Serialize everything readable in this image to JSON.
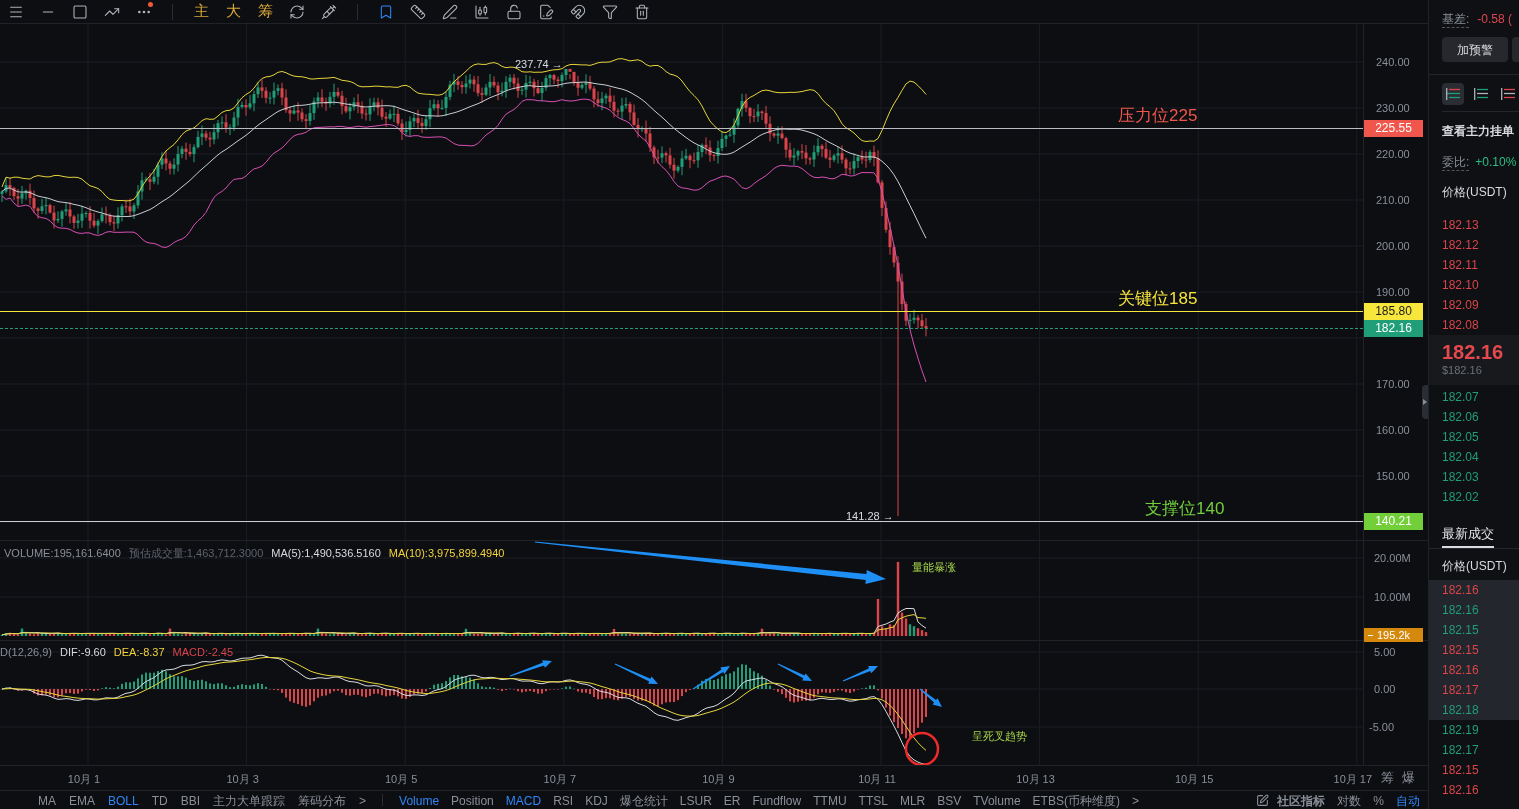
{
  "toolbar": {
    "indicator_buttons": [
      "主",
      "大",
      "筹"
    ]
  },
  "chart": {
    "high_label": "237.74 →",
    "low_label": "141.28 →",
    "levels": [
      {
        "kind": "resistance",
        "label": "压力位225",
        "badge": "225.55",
        "color": "#f0564c"
      },
      {
        "kind": "key",
        "label": "关键位185",
        "badge": "185.80",
        "color": "#f7e63c"
      },
      {
        "kind": "support",
        "label": "支撑位140",
        "badge": "140.21",
        "color": "#72cf3a"
      }
    ],
    "last_price": {
      "badge": "182.16",
      "color": "#1f9e78"
    },
    "price_ticks": [
      "240.00",
      "230.00",
      "220.00",
      "210.00",
      "200.00",
      "190.00"
    ],
    "lower_price_ticks": [
      "170.00",
      "160.00",
      "150.00"
    ]
  },
  "volume": {
    "legend": [
      {
        "text": "VOLUME:195,161.6400",
        "color": "#8a8f98"
      },
      {
        "text": "预估成交量:1,463,712.3000",
        "color": "#5d626b"
      },
      {
        "text": "MA(5):1,490,536.5160",
        "color": "#d9dbe0"
      },
      {
        "text": "MA(10):3,975,899.4940",
        "color": "#f2d43c"
      }
    ],
    "ticks": [
      "20.00M",
      "10.00M"
    ],
    "badge": "195.2k",
    "annotation": "量能暴涨"
  },
  "macd": {
    "legend": [
      {
        "text": "D(12,26,9)",
        "color": "#8a8f98"
      },
      {
        "text": "DIF:-9.60",
        "color": "#d9dbe0"
      },
      {
        "text": "DEA:-8.37",
        "color": "#f2d43c"
      },
      {
        "text": "MACD:-2.45",
        "color": "#d9454b"
      }
    ],
    "ticks": [
      "5.00",
      "0.00",
      "-5.00"
    ],
    "annotation": "呈死叉趋势"
  },
  "date_axis": [
    "10月 1",
    "10月 3",
    "10月 5",
    "10月 7",
    "10月 9",
    "10月 11",
    "10月 13",
    "10月 15",
    "10月 17"
  ],
  "axis_buttons": [
    "筹",
    "爆"
  ],
  "main_indicators": [
    {
      "label": "MA",
      "selected": false
    },
    {
      "label": "EMA",
      "selected": false
    },
    {
      "label": "BOLL",
      "selected": true
    },
    {
      "label": "TD",
      "selected": false
    },
    {
      "label": "BBI",
      "selected": false
    },
    {
      "label": "主力大单跟踪",
      "selected": false
    },
    {
      "label": "筹码分布",
      "selected": false
    },
    {
      "label": ">",
      "selected": false
    }
  ],
  "sub_indicators": [
    {
      "label": "Volume",
      "selected": true
    },
    {
      "label": "Position",
      "selected": false
    },
    {
      "label": "MACD",
      "selected": true
    },
    {
      "label": "RSI",
      "selected": false
    },
    {
      "label": "KDJ",
      "selected": false
    },
    {
      "label": "爆仓统计",
      "selected": false
    },
    {
      "label": "LSUR",
      "selected": false
    },
    {
      "label": "ER",
      "selected": false
    },
    {
      "label": "Fundflow",
      "selected": false
    },
    {
      "label": "TTMU",
      "selected": false
    },
    {
      "label": "TTSL",
      "selected": false
    },
    {
      "label": "MLR",
      "selected": false
    },
    {
      "label": "BSV",
      "selected": false
    },
    {
      "label": "TVolume",
      "selected": false
    },
    {
      "label": "ETBS(币种维度)",
      "selected": false
    },
    {
      "label": ">",
      "selected": false
    }
  ],
  "chart_options": [
    {
      "label": "社区指标",
      "selected": false
    },
    {
      "label": "对数",
      "selected": false
    },
    {
      "label": "%",
      "selected": false
    },
    {
      "label": "自动",
      "selected": true
    }
  ],
  "sidebar": {
    "basis_label": "基差:",
    "basis_value": "-0.58 (",
    "alert_button": "加预警",
    "book_views": [
      {
        "kind": "both",
        "selected": true
      },
      {
        "kind": "bids",
        "selected": false
      },
      {
        "kind": "asks",
        "selected": false
      }
    ],
    "main_orders": "查看主力挂单",
    "ratio_label": "委比:",
    "ratio_value": "+0.10%",
    "book_header": "价格(USDT)",
    "asks": [
      "182.13",
      "182.12",
      "182.11",
      "182.10",
      "182.09",
      "182.08"
    ],
    "mid_price": "182.16",
    "mid_price_usd": "$182.16",
    "bids": [
      "182.07",
      "182.06",
      "182.05",
      "182.04",
      "182.03",
      "182.02"
    ],
    "trades_tab": {
      "label": "最新成交",
      "selected": true
    },
    "trades_header": "价格(USDT)",
    "trades": [
      {
        "price": "182.16",
        "kind": "sell",
        "highlighted": true
      },
      {
        "price": "182.16",
        "kind": "buy",
        "highlighted": true
      },
      {
        "price": "182.15",
        "kind": "buy",
        "highlighted": true
      },
      {
        "price": "182.15",
        "kind": "sell",
        "highlighted": true
      },
      {
        "price": "182.16",
        "kind": "sell",
        "highlighted": true
      },
      {
        "price": "182.17",
        "kind": "sell",
        "highlighted": true
      },
      {
        "price": "182.18",
        "kind": "buy",
        "highlighted": true
      },
      {
        "price": "182.19",
        "kind": "buy",
        "highlighted": false
      },
      {
        "price": "182.17",
        "kind": "buy",
        "highlighted": false
      },
      {
        "price": "182.15",
        "kind": "sell",
        "highlighted": false
      },
      {
        "price": "182.16",
        "kind": "sell",
        "highlighted": false
      }
    ]
  }
}
